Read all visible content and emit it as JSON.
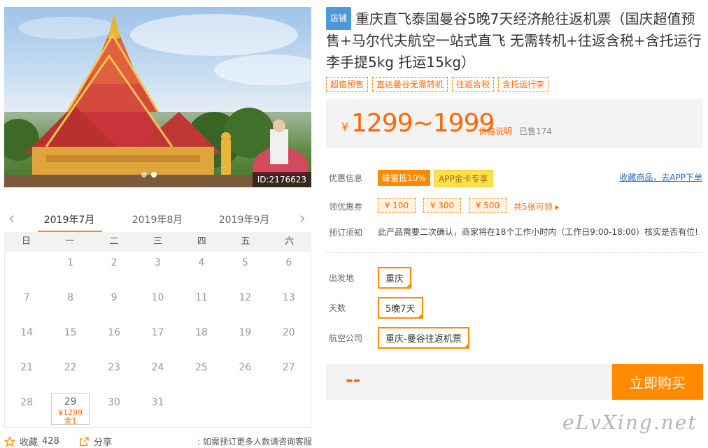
{
  "gallery": {
    "image_id": "ID:2176623",
    "dot_count": 2,
    "active_dot": 1
  },
  "calendar": {
    "months": [
      "2019年7月",
      "2019年8月",
      "2019年9月"
    ],
    "active_month": 0,
    "weekdays": [
      "日",
      "一",
      "二",
      "三",
      "四",
      "五",
      "六"
    ],
    "prev_icon": "chevron-left-icon",
    "next_icon": "chevron-right-icon",
    "first_day_offset": 1,
    "days_in_month": 31,
    "available": [
      {
        "day": "29",
        "price": "¥1299",
        "stock": "余1"
      }
    ]
  },
  "bottom": {
    "favorite_label": "收藏",
    "favorite_count": "428",
    "share_label": "分享",
    "tip": "如需预订更多人数请咨询客服"
  },
  "product": {
    "shop_badge": "店铺",
    "title": "重庆直飞泰国曼谷5晚7天经济舱往返机票（国庆超值预售+马尔代夫航空一站式直飞 无需转机+往返含税+含托运行李手提5kg 托运15kg）",
    "tags": [
      "超值预售",
      "直达曼谷无需转机",
      "往返含税",
      "含托运行李"
    ],
    "price_symbol": "¥",
    "price_range": "1299~1999",
    "price_explain": "价格说明",
    "sold": "已售174"
  },
  "promo": {
    "label": "优惠信息",
    "chip1": "蜂蜜抵10%",
    "chip2": "APP金卡专享",
    "fav_link": "收藏商品，去APP下单"
  },
  "coupons": {
    "label": "领优惠券",
    "items": [
      "¥ 100",
      "¥ 300",
      "¥ 500"
    ],
    "all": "共5张可领 ▸"
  },
  "notice": {
    "label": "预订须知",
    "text": "此产品需要二次确认，商家将在18个工作小时内（工作日9:00-18:00）核实是否有位!"
  },
  "options": {
    "departure_label": "出发地",
    "departure_value": "重庆",
    "days_label": "天数",
    "days_value": "5晚7天",
    "airline_label": "航空公司",
    "airline_value": "重庆-曼谷往返机票"
  },
  "buy": {
    "price_placeholder": "--",
    "button": "立即购买"
  },
  "watermark": "eLvXing.net",
  "colors": {
    "accent": "#ff8a00",
    "price": "#ff6600",
    "badge": "#4e98dc",
    "link": "#2c6fbf"
  }
}
